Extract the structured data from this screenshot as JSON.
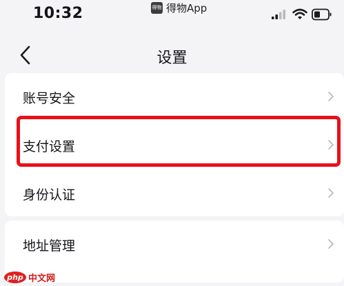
{
  "status_bar": {
    "time": "10:32",
    "app_name": "得物App",
    "app_logo_text": "得物"
  },
  "nav": {
    "title": "设置"
  },
  "settings": {
    "items": [
      {
        "label": "账号安全"
      },
      {
        "label": "支付设置"
      },
      {
        "label": "身份认证"
      },
      {
        "label": "地址管理"
      }
    ]
  },
  "highlight": {
    "target": "支付设置",
    "color": "#e8101b"
  },
  "watermark": {
    "logo_text": "php",
    "text": "中文网"
  }
}
